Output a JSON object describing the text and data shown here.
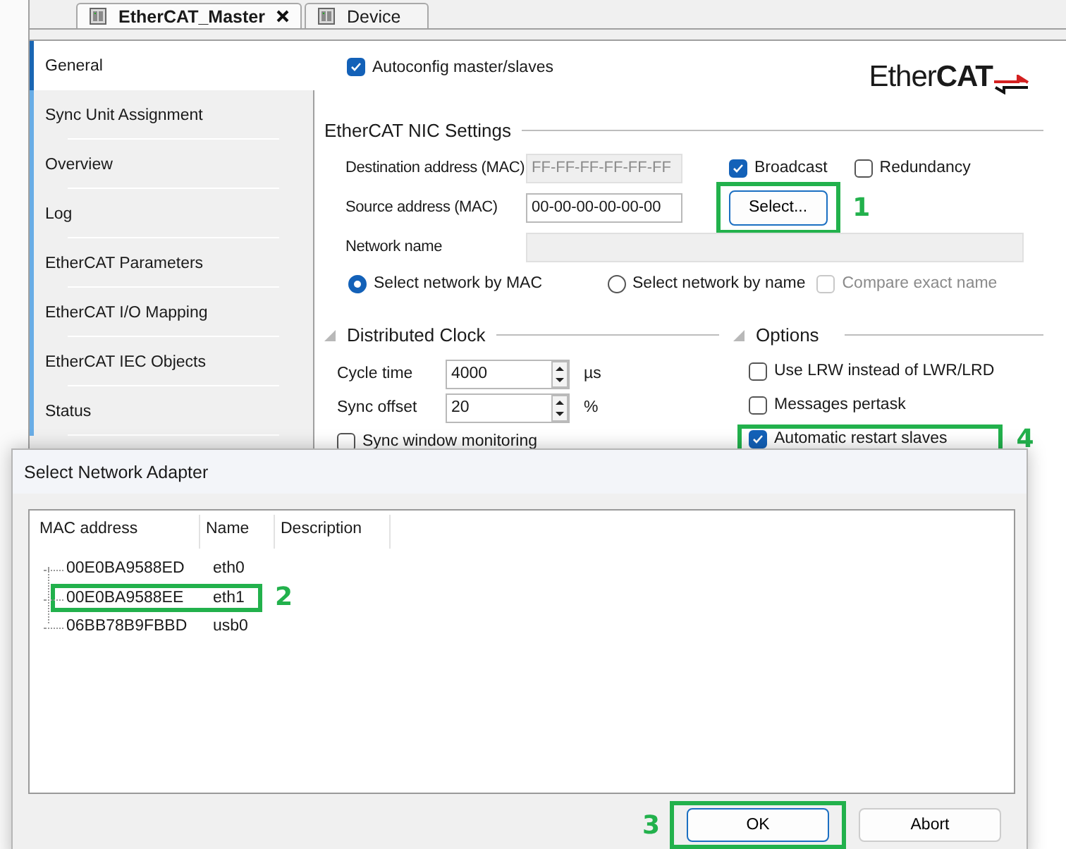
{
  "editor_tabs": [
    {
      "label": "EtherCAT_Master",
      "selected": true,
      "closable": true
    },
    {
      "label": "Device",
      "selected": false,
      "closable": false
    }
  ],
  "nav": [
    {
      "label": "General",
      "selected": true
    },
    {
      "label": "Sync Unit Assignment",
      "selected": false
    },
    {
      "label": "Overview",
      "selected": false
    },
    {
      "label": "Log",
      "selected": false
    },
    {
      "label": "EtherCAT Parameters",
      "selected": false
    },
    {
      "label": "EtherCAT I/O Mapping",
      "selected": false
    },
    {
      "label": "EtherCAT IEC Objects",
      "selected": false
    },
    {
      "label": "Status",
      "selected": false
    }
  ],
  "autoconfig": {
    "label": "Autoconfig master/slaves",
    "checked": true
  },
  "logo": {
    "light": "Ether",
    "bold": "CAT"
  },
  "nic": {
    "title": "EtherCAT NIC Settings",
    "destination": {
      "label": "Destination address (MAC)",
      "value": "FF-FF-FF-FF-FF-FF",
      "disabled": true
    },
    "broadcast": {
      "label": "Broadcast",
      "checked": true
    },
    "redundancy": {
      "label": "Redundancy",
      "checked": false
    },
    "source": {
      "label": "Source address (MAC)",
      "value": "00-00-00-00-00-00",
      "disabled": false
    },
    "select_button": {
      "label": "Select...",
      "marker": "1"
    },
    "network_name": {
      "label": "Network name",
      "disabled": true
    },
    "radios": [
      {
        "label": "Select network by MAC",
        "selected": true
      },
      {
        "label": "Select network by name",
        "selected": false
      }
    ],
    "compare": {
      "label": "Compare exact name",
      "checked": false,
      "disabled": true
    }
  },
  "dc": {
    "title": "Distributed Clock",
    "fields": [
      {
        "label": "Cycle time",
        "value": "4000",
        "unit": "µs"
      },
      {
        "label": "Sync offset",
        "value": "20",
        "unit": "%"
      }
    ],
    "sync_window": {
      "label": "Sync window monitoring",
      "checked": false
    }
  },
  "options": {
    "title": "Options",
    "items": [
      {
        "label": "Use LRW instead of LWR/LRD",
        "checked": false
      },
      {
        "label": "Messages pertask",
        "checked": false
      },
      {
        "label": "Automatic restart slaves",
        "checked": true,
        "marker": "4"
      }
    ]
  },
  "dialog": {
    "title": "Select Network Adapter",
    "columns": [
      "MAC address",
      "Name",
      "Description"
    ],
    "rows": [
      {
        "mac": "00E0BA9588ED",
        "name": "eth0"
      },
      {
        "mac": "00E0BA9588EE",
        "name": "eth1",
        "marker": "2"
      },
      {
        "mac": "06BB78B9FBBD",
        "name": "usb0"
      }
    ],
    "buttons": [
      {
        "label": "OK",
        "default": true,
        "marker": "3"
      },
      {
        "label": "Abort",
        "default": false
      }
    ]
  }
}
